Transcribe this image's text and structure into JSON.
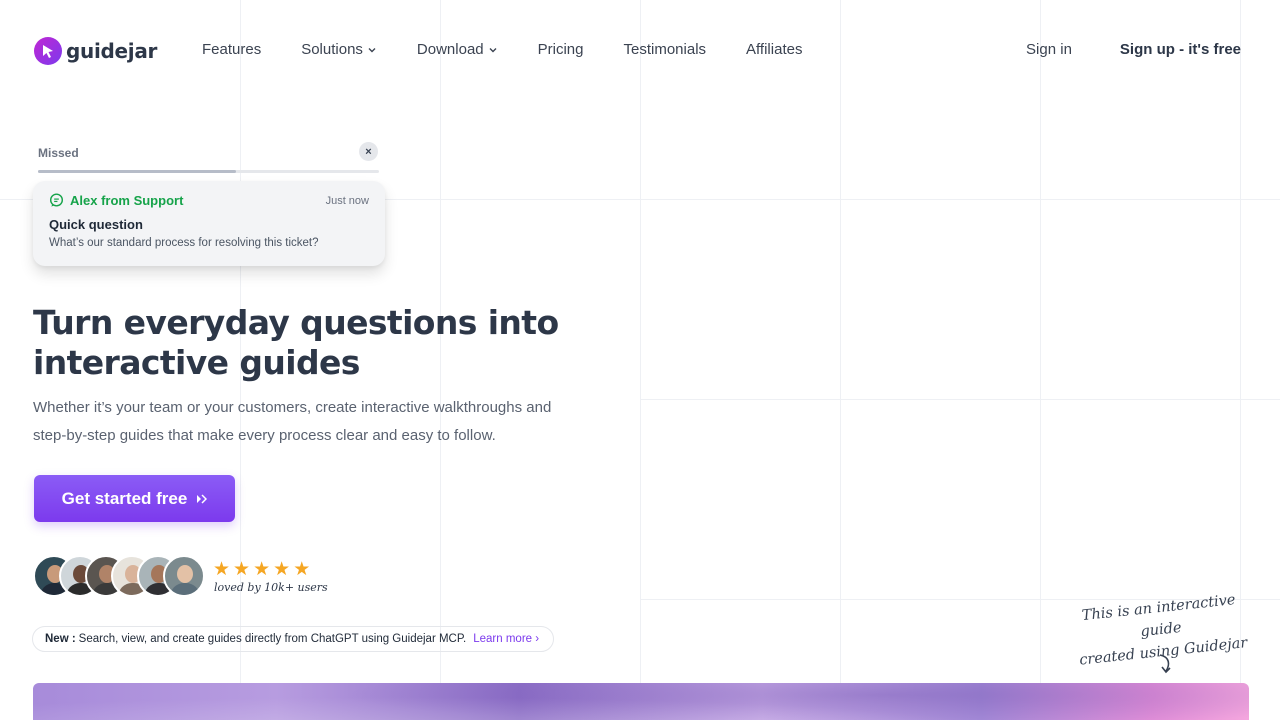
{
  "brand": {
    "name": "guidejar"
  },
  "nav": {
    "items": [
      {
        "label": "Features",
        "has_dropdown": false
      },
      {
        "label": "Solutions",
        "has_dropdown": true
      },
      {
        "label": "Download",
        "has_dropdown": true
      },
      {
        "label": "Pricing",
        "has_dropdown": false
      },
      {
        "label": "Testimonials",
        "has_dropdown": false
      },
      {
        "label": "Affiliates",
        "has_dropdown": false
      }
    ],
    "signin": "Sign in",
    "signup": "Sign up - it's free"
  },
  "notification": {
    "status": "Missed",
    "close": "×",
    "progress": 0.58,
    "from": "Alex from Support",
    "time": "Just now",
    "title": "Quick question",
    "body": "What’s our standard process for resolving this ticket?"
  },
  "hero": {
    "title_line1": "Turn everyday questions into",
    "title_line2": "interactive guides",
    "subtitle_line1": "Whether it’s your team or your customers, create interactive walkthroughs and",
    "subtitle_line2": "step-by-step guides that make every process clear and easy to follow.",
    "cta": "Get started free"
  },
  "social_proof": {
    "rating_stars": 5,
    "caption": "loved by 10k+ users"
  },
  "announcement": {
    "tag": "New :",
    "text": "Search, view, and create guides directly from ChatGPT using Guidejar MCP.",
    "link": "Learn more"
  },
  "note": {
    "line1": "This is an interactive guide",
    "line2": "created using Guidejar"
  },
  "colors": {
    "accent": "#7c3aed",
    "support_green": "#16a34a",
    "star": "#f5a623",
    "text_dark": "#2d3748"
  }
}
